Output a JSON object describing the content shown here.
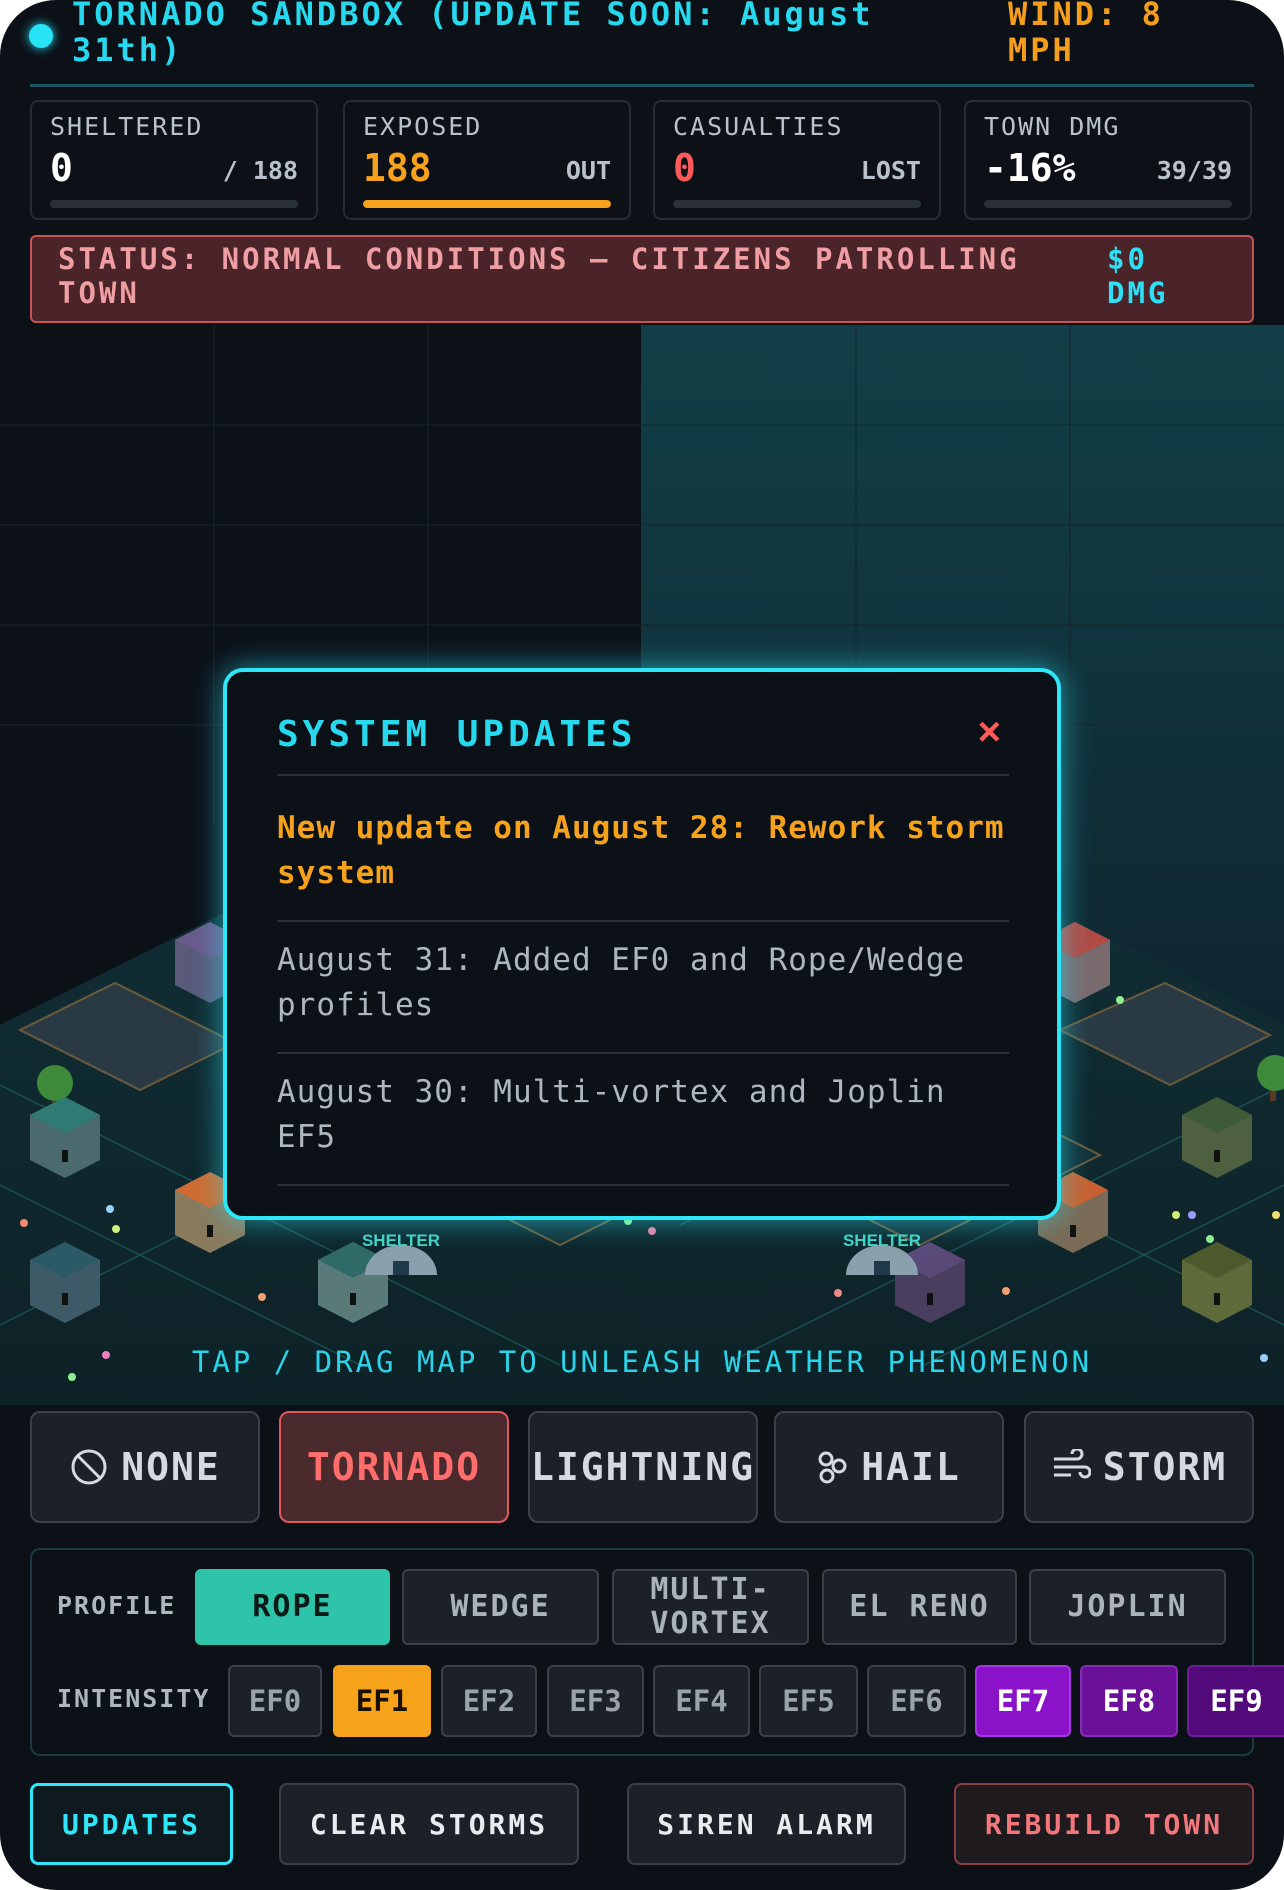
{
  "header": {
    "title": "TORNADO SANDBOX (UPDATE SOON: August 31th)",
    "wind": "WIND: 8 MPH"
  },
  "stats": [
    {
      "label": "SHELTERED",
      "value": "0",
      "sub": "/ 188",
      "fill": 0.0,
      "value_color": "#ffffff"
    },
    {
      "label": "EXPOSED",
      "value": "188",
      "sub": "OUT",
      "fill": 1.0,
      "value_color": "#f7a21b"
    },
    {
      "label": "CASUALTIES",
      "value": "0",
      "sub": "LOST",
      "fill": 0.0,
      "value_color": "#ff5a5a"
    },
    {
      "label": "TOWN DMG",
      "value": "-16%",
      "sub": "39/39",
      "fill": 0.0,
      "value_color": "#ffffff"
    }
  ],
  "status": {
    "text": "STATUS: NORMAL CONDITIONS — CITIZENS PATROLLING TOWN",
    "damage": "$0 DMG"
  },
  "map": {
    "shelter_label": "SHELTER",
    "hint": "TAP / DRAG MAP TO UNLEASH WEATHER PHENOMENON"
  },
  "modal": {
    "title": "SYSTEM UPDATES",
    "close": "×",
    "items": [
      "New update on August 28: Rework storm system",
      "August 31: Added EF0 and Rope/Wedge profiles",
      "August 30: Multi-vortex and Joplin EF5"
    ]
  },
  "weather_buttons": [
    {
      "label": "NONE",
      "icon": "ban-icon"
    },
    {
      "label": "TORNADO",
      "icon": ""
    },
    {
      "label": "LIGHTNING",
      "icon": ""
    },
    {
      "label": "HAIL",
      "icon": "hail-icon"
    },
    {
      "label": "STORM",
      "icon": "wind-icon"
    }
  ],
  "selected_weather": "TORNADO",
  "profile": {
    "label": "PROFILE",
    "options": [
      "ROPE",
      "WEDGE",
      "MULTI-VORTEX",
      "EL RENO",
      "JOPLIN"
    ],
    "selected": "ROPE"
  },
  "intensity": {
    "label": "INTENSITY",
    "options": [
      "EF0",
      "EF1",
      "EF2",
      "EF3",
      "EF4",
      "EF5",
      "EF6",
      "EF7",
      "EF8",
      "EF9"
    ],
    "selected": "EF1",
    "colors": {
      "EF7": "#8a12c8",
      "EF8": "#6a1099",
      "EF9": "#520a7a"
    }
  },
  "actions": [
    "UPDATES",
    "CLEAR STORMS",
    "SIREN ALARM",
    "REBUILD TOWN"
  ],
  "colors": {
    "accent": "#27d9ee",
    "warning": "#f7a21b",
    "danger": "#ff5a5a",
    "profile_selected": "#2ec4a9"
  }
}
